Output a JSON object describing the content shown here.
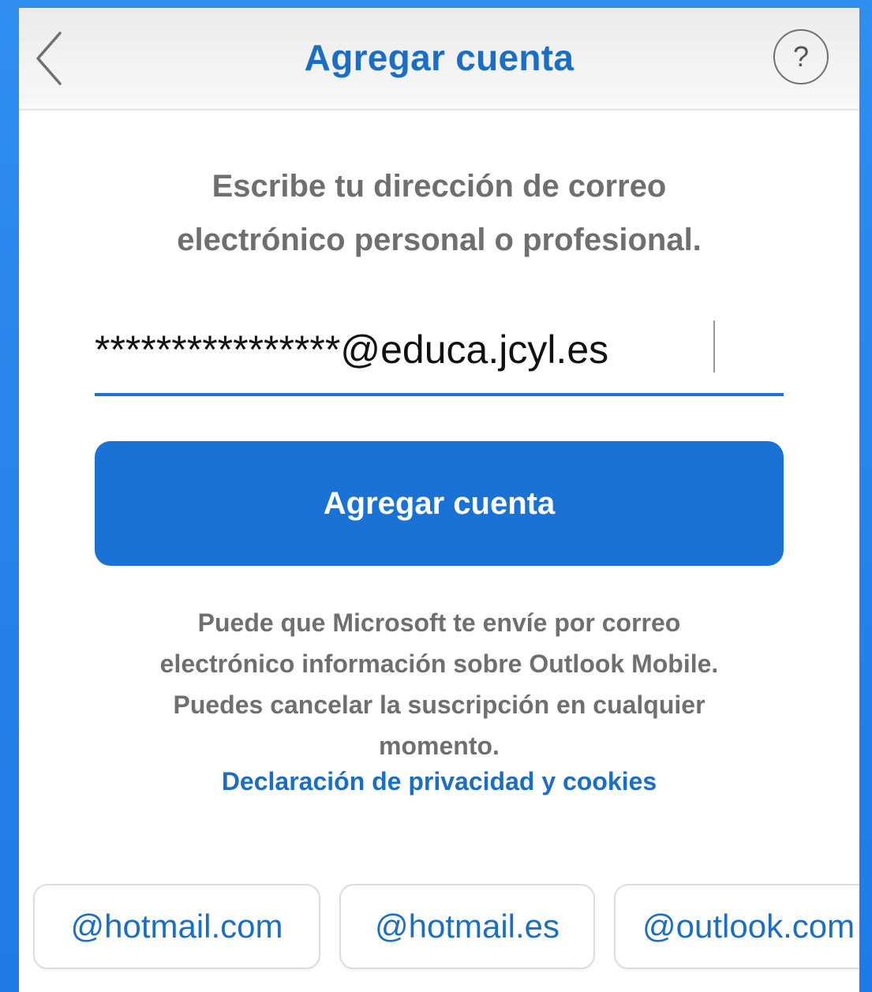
{
  "header": {
    "title": "Agregar cuenta",
    "help_label": "?"
  },
  "main": {
    "instructions_line1": "Escribe tu dirección de correo",
    "instructions_line2": "electrónico personal o profesional.",
    "email_value": "****************@educa.jcyl.es",
    "add_button_label": "Agregar cuenta",
    "disclaimer_line1": "Puede que Microsoft te envíe por correo",
    "disclaimer_line2": "electrónico información sobre Outlook Mobile.",
    "disclaimer_line3": "Puedes cancelar la suscripción en cualquier",
    "disclaimer_line4": "momento.",
    "privacy_link": "Declaración de privacidad y cookies"
  },
  "domain_suggestions": [
    "@hotmail.com",
    "@hotmail.es",
    "@outlook.com"
  ],
  "colors": {
    "accent": "#1a73d4",
    "title": "#1a6fc4",
    "secondary_text": "#6f6f6f",
    "background": "#2f8ef0"
  }
}
